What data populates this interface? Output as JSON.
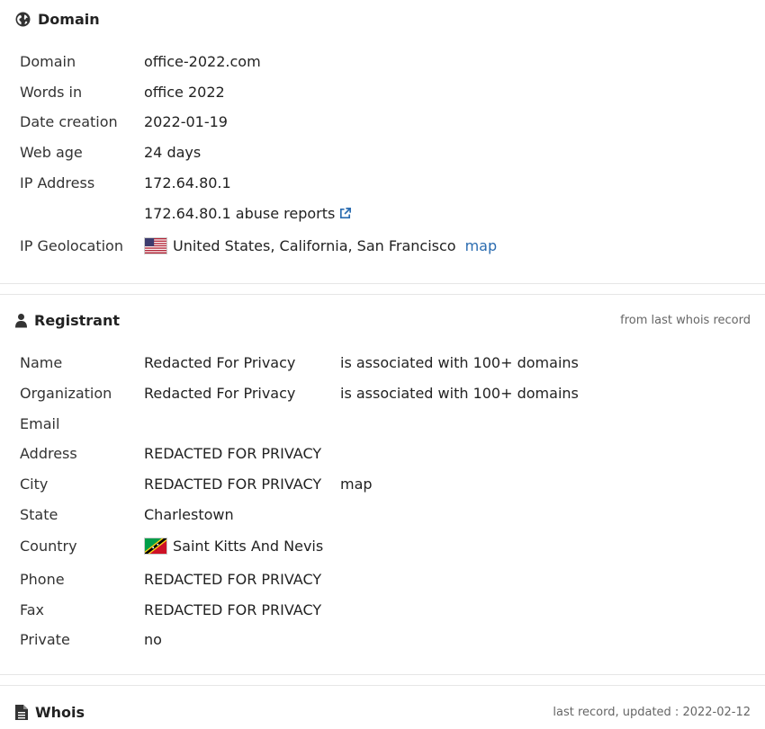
{
  "domain_section": {
    "title": "Domain",
    "icon": "globe-icon",
    "rows": {
      "domain": {
        "label": "Domain",
        "value": "office-2022.com"
      },
      "words_in": {
        "label": "Words in",
        "value": "office 2022"
      },
      "date_creation": {
        "label": "Date creation",
        "value": "2022-01-19"
      },
      "web_age": {
        "label": "Web age",
        "value": "24 days"
      },
      "ip_address": {
        "label": "IP Address",
        "value": "172.64.80.1"
      },
      "abuse_reports": {
        "value": "172.64.80.1 abuse reports"
      },
      "ip_geolocation": {
        "label": "IP Geolocation",
        "value": "United States, California, San Francisco",
        "map_label": "map",
        "flag": "us-flag-icon"
      }
    }
  },
  "registrant_section": {
    "title": "Registrant",
    "icon": "user-icon",
    "note": "from last whois record",
    "rows": {
      "name": {
        "label": "Name",
        "value": "Redacted For Privacy",
        "extra": "is associated with 100+ domains"
      },
      "organization": {
        "label": "Organization",
        "value": "Redacted For Privacy",
        "extra": "is associated with 100+ domains"
      },
      "email": {
        "label": "Email",
        "value": ""
      },
      "address": {
        "label": "Address",
        "value": "REDACTED FOR PRIVACY"
      },
      "city": {
        "label": "City",
        "value": "REDACTED FOR PRIVACY",
        "map_label": "map"
      },
      "state": {
        "label": "State",
        "value": "Charlestown"
      },
      "country": {
        "label": "Country",
        "value": "Saint Kitts And Nevis",
        "flag": "kn-flag-icon"
      },
      "phone": {
        "label": "Phone",
        "value": "REDACTED FOR PRIVACY"
      },
      "fax": {
        "label": "Fax",
        "value": "REDACTED FOR PRIVACY"
      },
      "private": {
        "label": "Private",
        "value": "no"
      }
    }
  },
  "whois_section": {
    "title": "Whois",
    "icon": "document-icon",
    "note": "last record, updated : 2022-02-12"
  },
  "colors": {
    "link": "#2b6cb0",
    "text": "#222222",
    "muted": "#666666",
    "divider": "#e6e6e6"
  }
}
